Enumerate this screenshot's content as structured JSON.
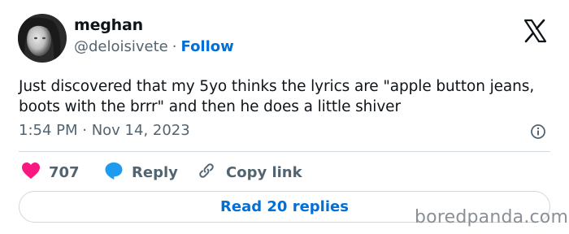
{
  "author": {
    "display_name": "meghan",
    "handle": "@deloisivete",
    "separator": "·",
    "follow_label": "Follow"
  },
  "tweet": {
    "text_line1": "Just discovered that my 5yo thinks the lyrics are \"apple button jeans,",
    "text_line2": "boots with the brrr\" and then he does a little shiver",
    "timestamp": "1:54 PM · Nov 14, 2023"
  },
  "actions": {
    "like_count": "707",
    "reply_label": "Reply",
    "copy_link_label": "Copy link"
  },
  "read_replies_label": "Read 20 replies",
  "watermark": "boredpanda.com",
  "colors": {
    "like": "#f91880",
    "link": "#006fd6",
    "reply_icon": "#1d9bf0",
    "secondary_text": "#536471"
  },
  "icons": [
    "x-logo-icon",
    "info-icon",
    "heart-icon",
    "reply-bubble-icon",
    "link-icon"
  ]
}
